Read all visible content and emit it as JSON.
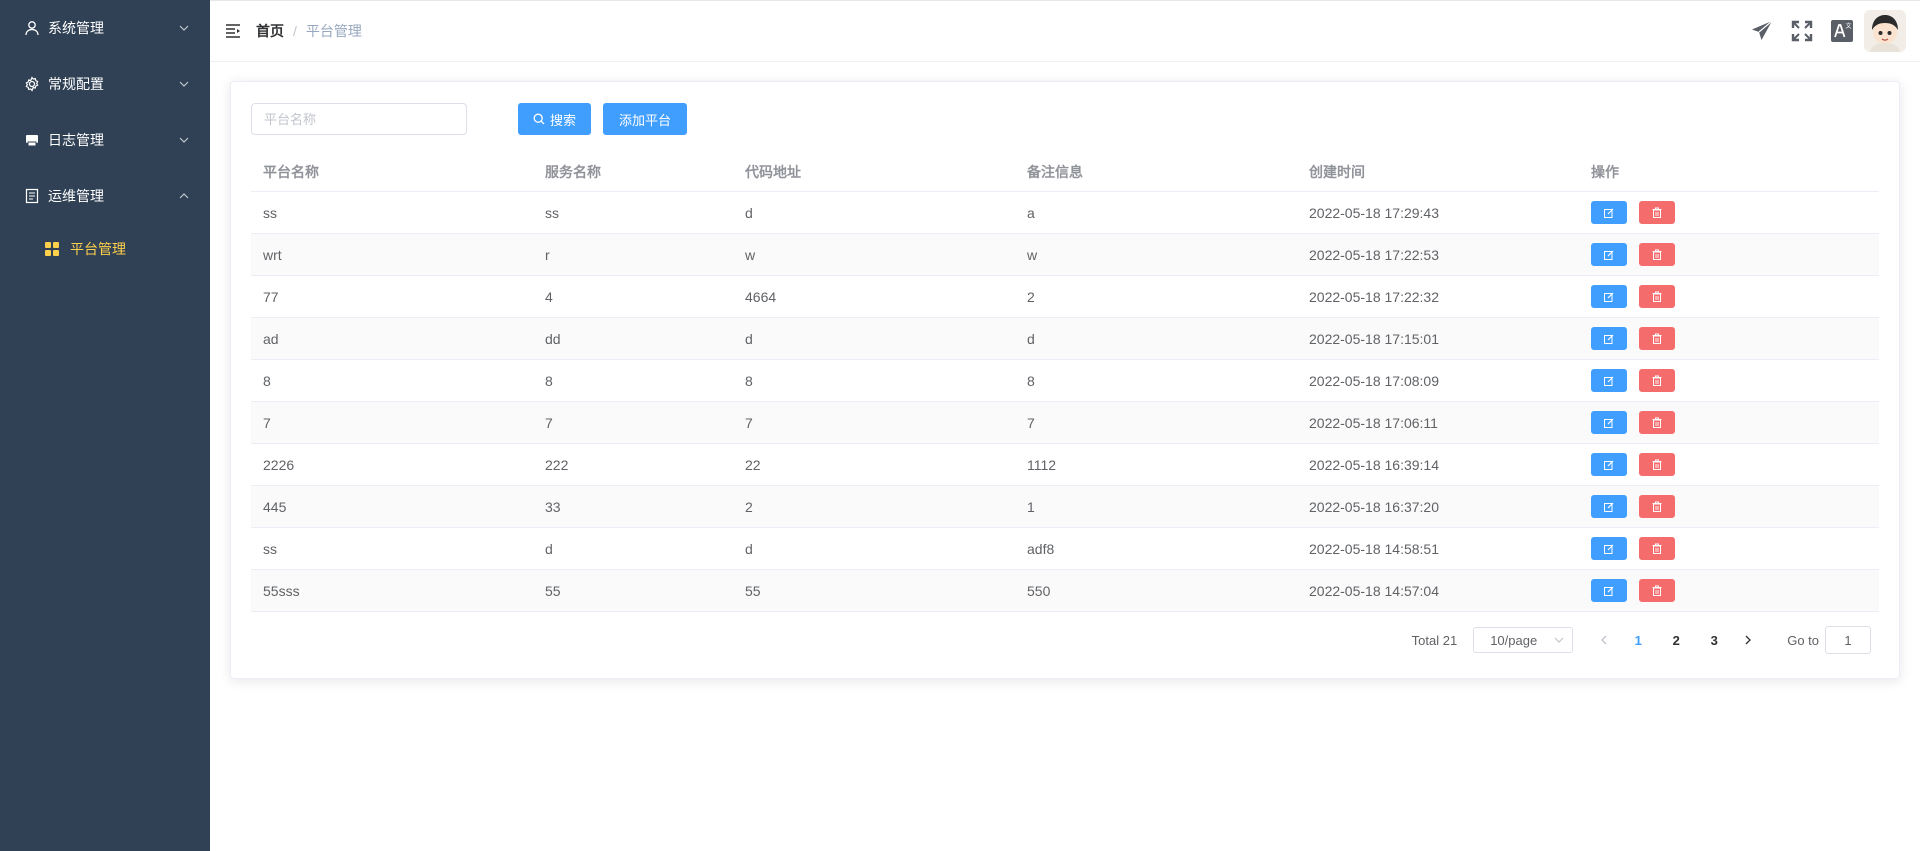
{
  "sidebar": {
    "menus": [
      {
        "label": "系统管理",
        "icon": "user-icon",
        "expanded": false
      },
      {
        "label": "常规配置",
        "icon": "gear-icon",
        "expanded": false
      },
      {
        "label": "日志管理",
        "icon": "printer-icon",
        "expanded": false
      },
      {
        "label": "运维管理",
        "icon": "document-icon",
        "expanded": true
      }
    ],
    "submenu": {
      "label": "平台管理",
      "icon": "grid-icon",
      "active": true
    }
  },
  "header": {
    "breadcrumb": {
      "home": "首页",
      "separator": "/",
      "current": "平台管理"
    },
    "icons": [
      "send-icon",
      "fullscreen-icon",
      "translate-icon",
      "avatar"
    ]
  },
  "toolbar": {
    "search_placeholder": "平台名称",
    "search_value": "",
    "search_label": "搜索",
    "add_label": "添加平台"
  },
  "table": {
    "columns": [
      "平台名称",
      "服务名称",
      "代码地址",
      "备注信息",
      "创建时间",
      "操作"
    ],
    "rows": [
      [
        "ss",
        "ss",
        "d",
        "a",
        "2022-05-18 17:29:43"
      ],
      [
        "wrt",
        "r",
        "w",
        "w",
        "2022-05-18 17:22:53"
      ],
      [
        "77",
        "4",
        "4664",
        "2",
        "2022-05-18 17:22:32"
      ],
      [
        "ad",
        "dd",
        "d",
        "d",
        "2022-05-18 17:15:01"
      ],
      [
        "8",
        "8",
        "8",
        "8",
        "2022-05-18 17:08:09"
      ],
      [
        "7",
        "7",
        "7",
        "7",
        "2022-05-18 17:06:11"
      ],
      [
        "2226",
        "222",
        "22",
        "1112",
        "2022-05-18 16:39:14"
      ],
      [
        "445",
        "33",
        "2",
        "1",
        "2022-05-18 16:37:20"
      ],
      [
        "ss",
        "d",
        "d",
        "adf8",
        "2022-05-18 14:58:51"
      ],
      [
        "55sss",
        "55",
        "55",
        "550",
        "2022-05-18 14:57:04"
      ]
    ]
  },
  "pagination": {
    "total": "Total 21",
    "page_size": "10/page",
    "pages": [
      "1",
      "2",
      "3"
    ],
    "current_page": "1",
    "goto_label": "Go to",
    "goto_value": "1"
  },
  "colors": {
    "sidebar_bg": "#304156",
    "active_menu": "#ffd04b",
    "primary": "#409eff",
    "danger": "#f56c6c"
  }
}
